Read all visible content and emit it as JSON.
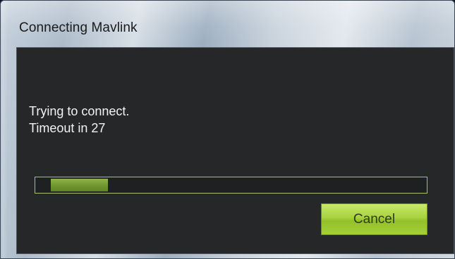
{
  "dialog": {
    "title": "Connecting Mavlink",
    "message_line1": "Trying to connect.",
    "message_line2": "Timeout in 27",
    "progress": {
      "start_fraction": 0.04,
      "end_fraction": 0.185
    },
    "cancel_label": "Cancel"
  },
  "colors": {
    "client_background": "#262729",
    "progress_border": "#a9c26a",
    "progress_fill": "#7aa337",
    "button_green": "#a8d23e",
    "text_light": "#f2f2f2"
  }
}
